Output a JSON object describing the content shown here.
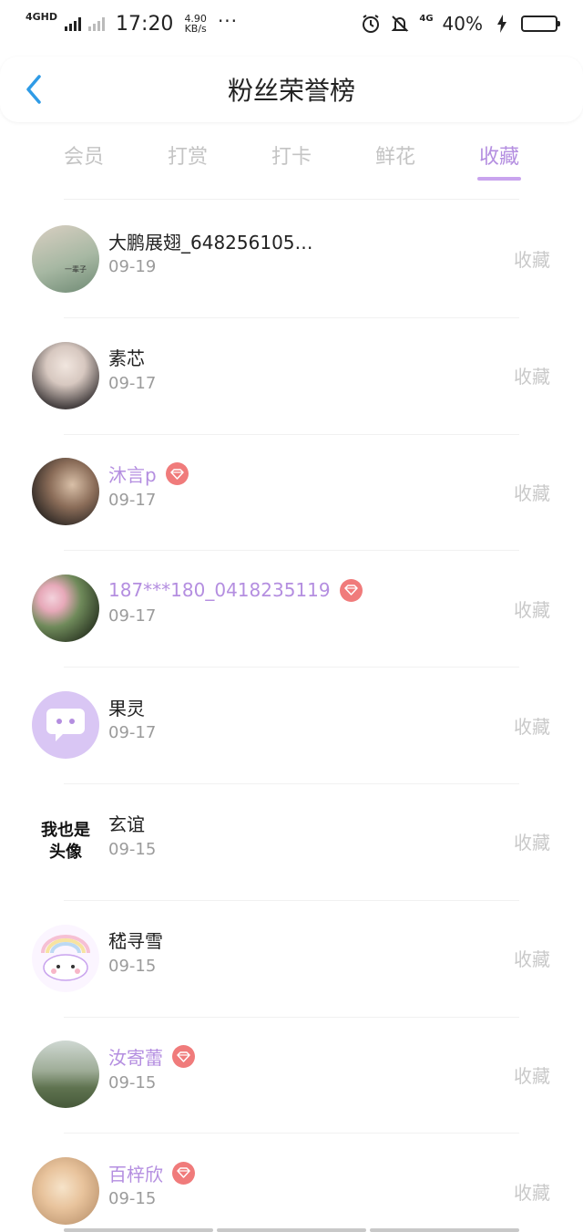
{
  "status_bar": {
    "network": "4GHD",
    "time": "17:20",
    "speed_value": "4.90",
    "speed_unit": "KB/s",
    "more": "···",
    "network2": "4G",
    "battery": "40%",
    "battery_level": 0.4
  },
  "header": {
    "title": "粉丝荣誉榜"
  },
  "tabs": [
    {
      "label": "会员",
      "active": false
    },
    {
      "label": "打赏",
      "active": false
    },
    {
      "label": "打卡",
      "active": false
    },
    {
      "label": "鲜花",
      "active": false
    },
    {
      "label": "收藏",
      "active": true
    }
  ],
  "fans": [
    {
      "name": "大鹏展翅_648256105…",
      "date": "09-19",
      "action": "收藏",
      "vip": false,
      "avatar_text": "一辈子"
    },
    {
      "name": "素芯",
      "date": "09-17",
      "action": "收藏",
      "vip": false,
      "avatar_text": ""
    },
    {
      "name": "沐言p",
      "date": "09-17",
      "action": "收藏",
      "vip": true,
      "avatar_text": ""
    },
    {
      "name": "187***180_0418235119",
      "date": "09-17",
      "action": "收藏",
      "vip": true,
      "avatar_text": ""
    },
    {
      "name": "果灵",
      "date": "09-17",
      "action": "收藏",
      "vip": false,
      "avatar_text": ""
    },
    {
      "name": "玄谊",
      "date": "09-15",
      "action": "收藏",
      "vip": false,
      "avatar_text": "我也是头像"
    },
    {
      "name": "嵇寻雪",
      "date": "09-15",
      "action": "收藏",
      "vip": false,
      "avatar_text": ""
    },
    {
      "name": "汝寄蕾",
      "date": "09-15",
      "action": "收藏",
      "vip": true,
      "avatar_text": ""
    },
    {
      "name": "百梓欣",
      "date": "09-15",
      "action": "收藏",
      "vip": true,
      "avatar_text": ""
    }
  ],
  "colors": {
    "accent": "#b48ee0",
    "badge": "#f07b7b",
    "back_arrow": "#2f9be6"
  }
}
